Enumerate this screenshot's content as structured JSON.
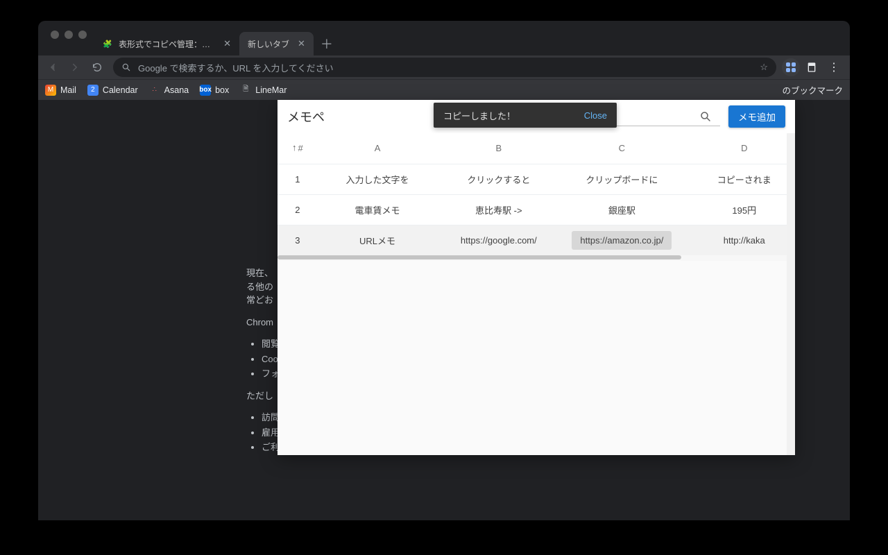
{
  "tabs": [
    {
      "title": "表形式でコピペ管理：メモペ - ア",
      "active": false
    },
    {
      "title": "新しいタブ",
      "active": true
    }
  ],
  "omnibox": {
    "placeholder": "Google で検索するか、URL を入力してください"
  },
  "bookmarks": {
    "items": [
      {
        "label": "Mail",
        "icon": "gmail"
      },
      {
        "label": "Calendar",
        "icon": "calendar"
      },
      {
        "label": "Asana",
        "icon": "asana"
      },
      {
        "label": "box",
        "icon": "box"
      },
      {
        "label": "LineMar",
        "icon": "doc"
      }
    ],
    "other": "のブックマーク"
  },
  "incognito": {
    "line1": "現在、",
    "line2": "る他の",
    "line3": "常どお",
    "section": "Chrom",
    "bullets1": [
      "閲覧",
      "Coo",
      "フォ"
    ],
    "section2": "ただし",
    "bullets2": [
      "訪問",
      "雇用",
      "ご利"
    ]
  },
  "popup": {
    "title": "メモペ",
    "toast_message": "コピーしました！",
    "toast_close": "Close",
    "add_button": "メモ追加",
    "columns": {
      "idx": "#",
      "a": "A",
      "b": "B",
      "c": "C",
      "d": "D"
    },
    "rows": [
      {
        "idx": "1",
        "a": "入力した文字を",
        "b": "クリックすると",
        "c": "クリップボードに",
        "d": "コピーされま"
      },
      {
        "idx": "2",
        "a": "電車賃メモ",
        "b": "恵比寿駅 ->",
        "c": "銀座駅",
        "d": "195円"
      },
      {
        "idx": "3",
        "a": "URLメモ",
        "b": "https://google.com/",
        "c": "https://amazon.co.jp/",
        "d": "http://kaka"
      }
    ]
  }
}
